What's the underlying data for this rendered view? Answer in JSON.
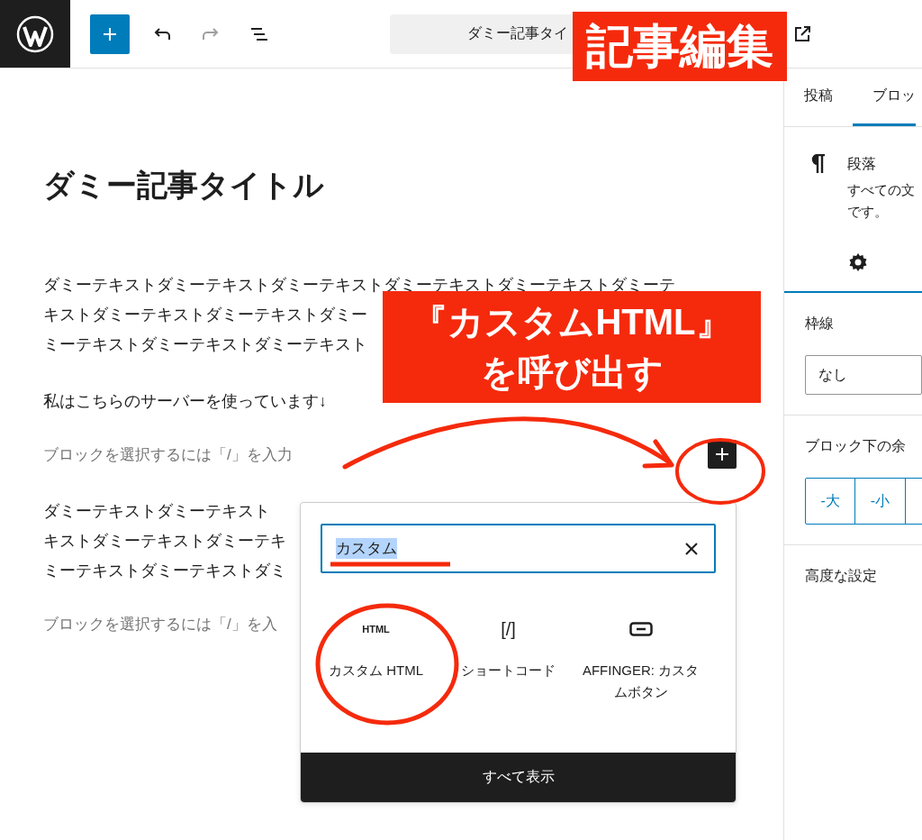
{
  "toolbar": {
    "title_field": "ダミー記事タイ",
    "history": [
      {
        "kind": "undo",
        "disabled": false
      },
      {
        "kind": "redo",
        "disabled": true
      }
    ]
  },
  "post": {
    "title": "ダミー記事タイトル",
    "blocks": [
      {
        "kind": "paragraph",
        "lines": [
          "ダミーテキストダミーテキストダミーテキストダミーテキストダミーテキストダミーテ",
          "キストダミーテキストダミーテキストダミー",
          "ミーテキストダミーテキストダミーテキスト"
        ]
      },
      {
        "kind": "paragraph",
        "lines": [
          "私はこちらのサーバーを使っています↓"
        ]
      },
      {
        "kind": "placeholder",
        "text": "ブロックを選択するには「/」を入力",
        "inserter": true
      },
      {
        "kind": "paragraph",
        "lines": [
          "ダミーテキストダミーテキスト",
          "キストダミーテキストダミーテキ",
          "ミーテキストダミーテキストダミ"
        ]
      },
      {
        "kind": "placeholder",
        "text": "ブロックを選択するには「/」を入"
      }
    ]
  },
  "inserter": {
    "search_value": "カスタム",
    "results": [
      {
        "kind": "html",
        "icon_text": "HTML",
        "label": "カスタム HTML"
      },
      {
        "kind": "shortcode",
        "icon_text": "[/]",
        "label": "ショートコード"
      },
      {
        "kind": "button",
        "label": "AFFINGER: カスタムボタン"
      }
    ],
    "browse_all": "すべて表示"
  },
  "sidebar": {
    "tabs": [
      {
        "label": "投稿",
        "selected": false
      },
      {
        "label": "ブロッ",
        "selected": true
      }
    ],
    "block_card": {
      "title": "段落",
      "description_lines": [
        "すべての文",
        "です。"
      ]
    },
    "sections": [
      {
        "kind": "select",
        "label": "枠線",
        "value": "なし"
      },
      {
        "kind": "segmented",
        "label": "ブロック下の余",
        "options": [
          "-大",
          "-小"
        ]
      },
      {
        "kind": "collapsed",
        "label": "高度な設定"
      }
    ]
  },
  "annotations": [
    {
      "lines": [
        "記事編集"
      ]
    },
    {
      "lines": [
        "『カスタムHTML』",
        "を呼び出す"
      ]
    }
  ]
}
